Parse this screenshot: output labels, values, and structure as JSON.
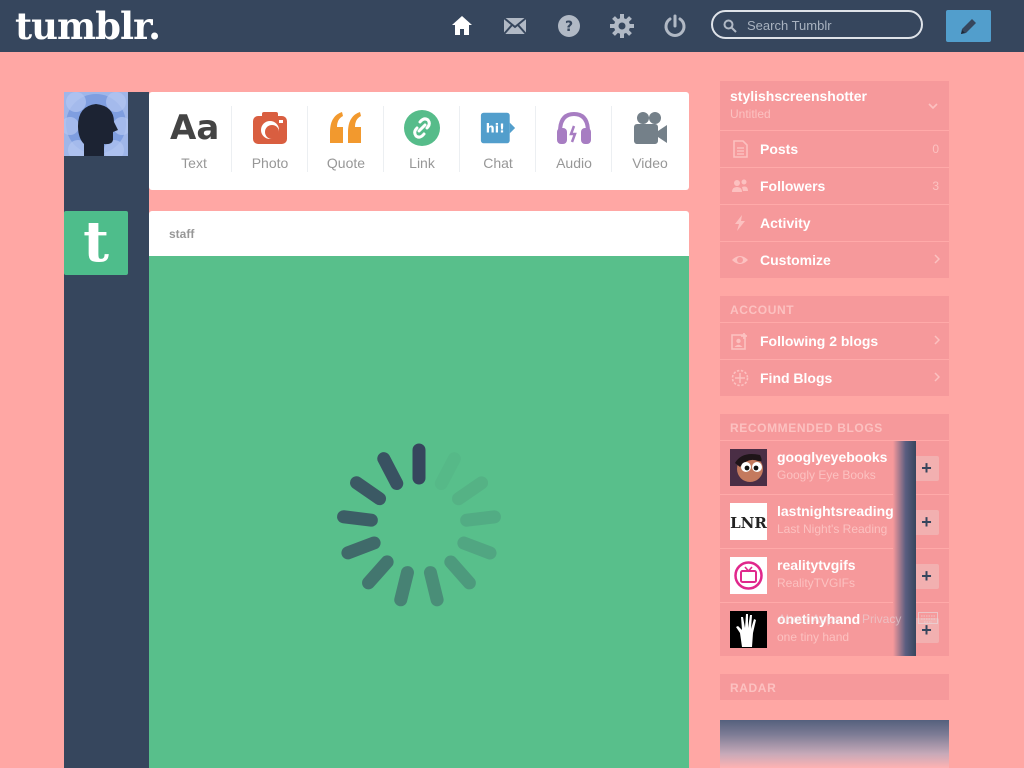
{
  "header": {
    "logo": "tumblr.",
    "search_placeholder": "Search Tumblr",
    "nav_icons": [
      "home-icon",
      "mail-icon",
      "help-icon",
      "gear-icon",
      "power-icon"
    ],
    "compose_icon": "pencil-icon"
  },
  "post_types": [
    {
      "label": "Text",
      "icon": "text-icon",
      "color": "#444444"
    },
    {
      "label": "Photo",
      "icon": "camera-icon",
      "color": "#d95e40"
    },
    {
      "label": "Quote",
      "icon": "quote-icon",
      "color": "#f2992e"
    },
    {
      "label": "Link",
      "icon": "link-icon",
      "color": "#56bc8a"
    },
    {
      "label": "Chat",
      "icon": "chat-icon",
      "color": "#529ecc"
    },
    {
      "label": "Audio",
      "icon": "headphones-icon",
      "color": "#a77dc2"
    },
    {
      "label": "Video",
      "icon": "video-camera-icon",
      "color": "#748089"
    }
  ],
  "post": {
    "author": "staff",
    "media_color": "#58bf8b"
  },
  "sidebar": {
    "blog": {
      "name": "stylishscreenshotter",
      "subtitle": "Untitled"
    },
    "items": [
      {
        "label": "Posts",
        "count": "0",
        "icon": "document-icon"
      },
      {
        "label": "Followers",
        "count": "3",
        "icon": "people-icon"
      },
      {
        "label": "Activity",
        "icon": "lightning-icon"
      },
      {
        "label": "Customize",
        "icon": "eye-icon"
      }
    ],
    "account_title": "ACCOUNT",
    "account_items": [
      {
        "label": "Following 2 blogs",
        "icon": "add-user-icon"
      },
      {
        "label": "Find Blogs",
        "icon": "compass-icon"
      }
    ],
    "recommended_title": "RECOMMENDED BLOGS",
    "recommended": [
      {
        "name": "googlyeyebooks",
        "title": "Googly Eye Books"
      },
      {
        "name": "lastnightsreading",
        "title": "Last Night's Reading"
      },
      {
        "name": "realitytvgifs",
        "title": "RealityTVGIFs"
      },
      {
        "name": "onetinyhand",
        "title": "one tiny hand"
      }
    ],
    "overlay_text": "About  Apps",
    "overlay_text2": "Privacy",
    "radar_title": "RADAR"
  }
}
